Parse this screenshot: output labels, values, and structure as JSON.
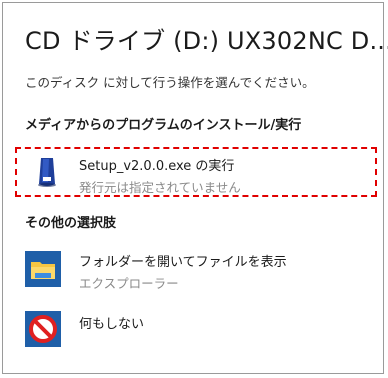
{
  "dialog": {
    "title": "CD ドライブ (D:) UX302NC D...",
    "prompt": "このディスク に対して行う操作を選んでください。"
  },
  "sections": {
    "media_heading": "メディアからのプログラムのインストール/実行",
    "other_heading": "その他の選択肢"
  },
  "options": {
    "run_setup": {
      "label": "Setup_v2.0.0.exe の実行",
      "detail": "発行元は指定されていません",
      "icon": "setup-app-icon"
    },
    "open_folder": {
      "label": "フォルダーを開いてファイルを表示",
      "detail": "エクスプローラー",
      "icon": "folder-icon"
    },
    "take_no_action": {
      "label": "何もしない",
      "icon": "no-action-icon"
    }
  },
  "colors": {
    "highlight_border": "#e00000",
    "secondary_text": "#8a8a8a",
    "icon_blue": "#1f5fa8"
  }
}
